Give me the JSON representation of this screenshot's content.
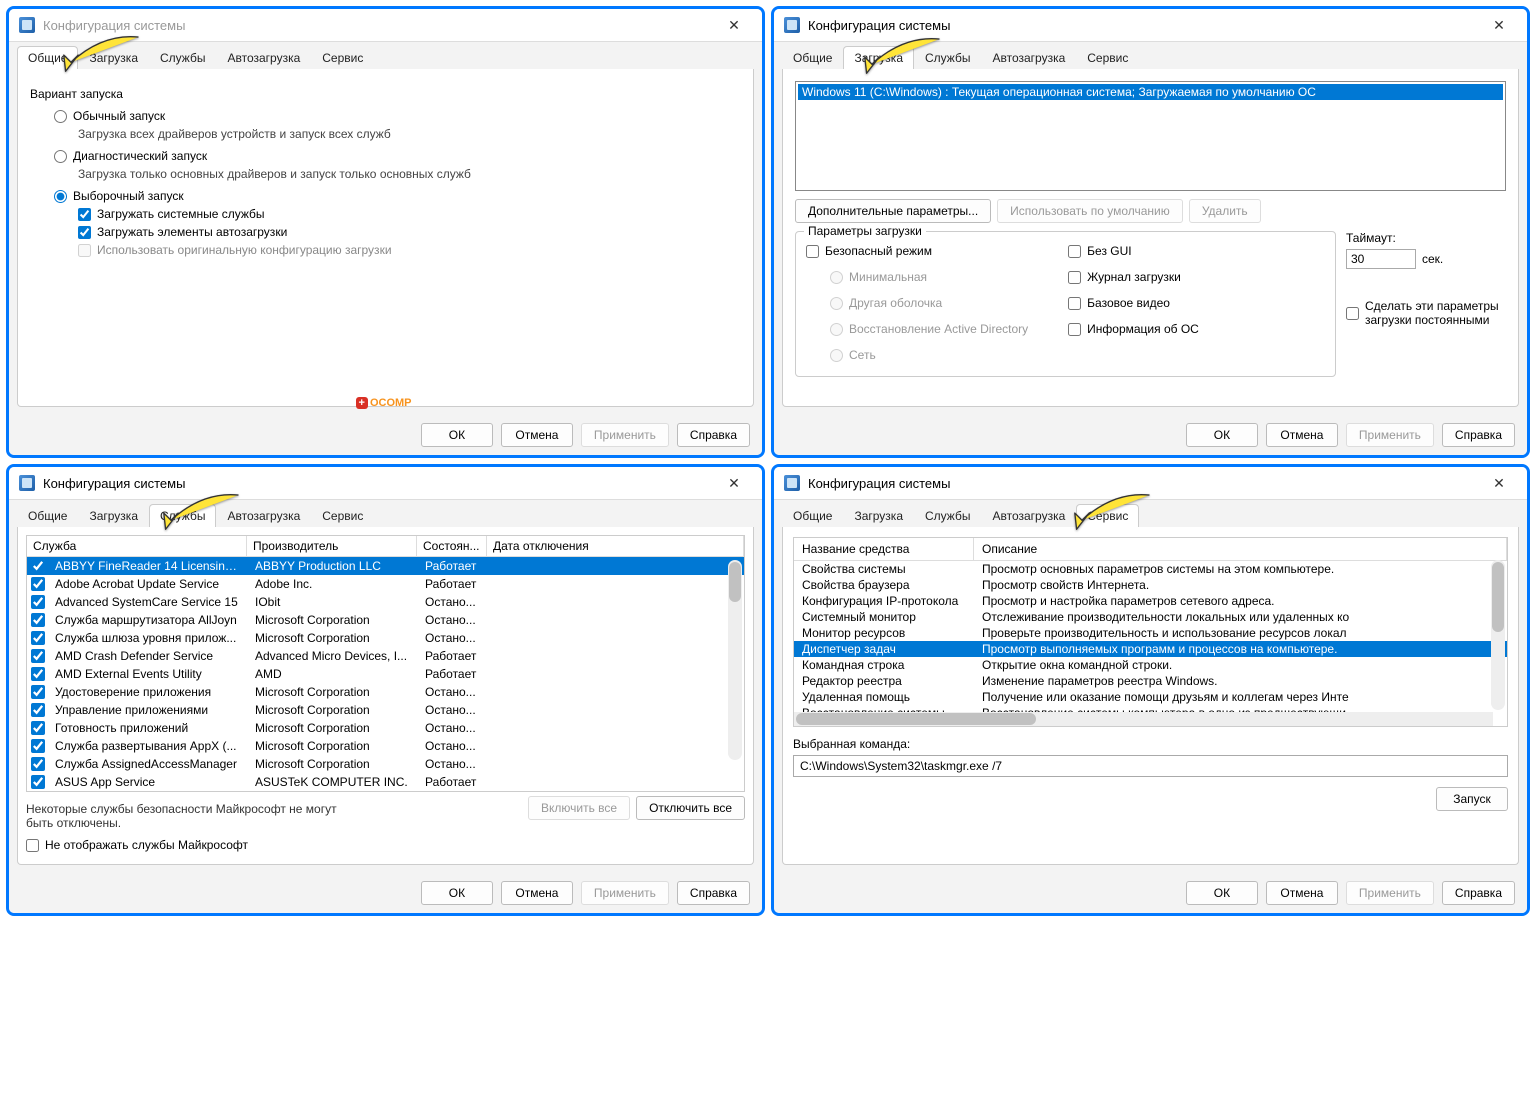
{
  "title": "Конфигурация системы",
  "tabs": [
    "Общие",
    "Загрузка",
    "Службы",
    "Автозагрузка",
    "Сервис"
  ],
  "buttons": {
    "ok": "ОК",
    "cancel": "Отмена",
    "apply": "Применить",
    "help": "Справка"
  },
  "w1": {
    "groupTitle": "Вариант запуска",
    "r1": "Обычный запуск",
    "r1d": "Загрузка всех драйверов устройств и запуск всех служб",
    "r2": "Диагностический запуск",
    "r2d": "Загрузка только основных драйверов и запуск только основных служб",
    "r3": "Выборочный запуск",
    "c1": "Загружать системные службы",
    "c2": "Загружать элементы автозагрузки",
    "c3": "Использовать оригинальную конфигурацию загрузки"
  },
  "w2": {
    "osline": "Windows 11 (C:\\Windows) : Текущая операционная система; Загружаемая по умолчанию ОС",
    "advbtn": "Дополнительные параметры...",
    "defbtn": "Использовать по умолчанию",
    "delbtn": "Удалить",
    "bootopts": "Параметры загрузки",
    "safe": "Безопасный режим",
    "min": "Минимальная",
    "shell": "Другая оболочка",
    "ad": "Восстановление Active Directory",
    "net": "Сеть",
    "nogui": "Без GUI",
    "bootlog": "Журнал загрузки",
    "basevid": "Базовое видео",
    "osinfo": "Информация об ОС",
    "timeout": "Таймаут:",
    "timeoutval": "30",
    "sec": "сек.",
    "persist": "Сделать эти параметры загрузки постоянными"
  },
  "w3": {
    "hdr": [
      "Служба",
      "Производитель",
      "Состоян...",
      "Дата отключения"
    ],
    "rows": [
      [
        "ABBYY FineReader 14 Licensing ...",
        "ABBYY Production LLC",
        "Работает"
      ],
      [
        "Adobe Acrobat Update Service",
        "Adobe Inc.",
        "Работает"
      ],
      [
        "Advanced SystemCare Service 15",
        "IObit",
        "Остано..."
      ],
      [
        "Служба маршрутизатора AllJoyn",
        "Microsoft Corporation",
        "Остано..."
      ],
      [
        "Служба шлюза уровня прилож...",
        "Microsoft Corporation",
        "Остано..."
      ],
      [
        "AMD Crash Defender Service",
        "Advanced Micro Devices, I...",
        "Работает"
      ],
      [
        "AMD External Events Utility",
        "AMD",
        "Работает"
      ],
      [
        "Удостоверение приложения",
        "Microsoft Corporation",
        "Остано..."
      ],
      [
        "Управление приложениями",
        "Microsoft Corporation",
        "Остано..."
      ],
      [
        "Готовность приложений",
        "Microsoft Corporation",
        "Остано..."
      ],
      [
        "Служба развертывания AppX (...",
        "Microsoft Corporation",
        "Остано..."
      ],
      [
        "Служба AssignedAccessManager",
        "Microsoft Corporation",
        "Остано..."
      ],
      [
        "ASUS App Service",
        "ASUSTeK COMPUTER INC.",
        "Работает"
      ]
    ],
    "note": "Некоторые службы безопасности Майкрософт не могут быть отключены.",
    "hide": "Не отображать службы Майкрософт",
    "enall": "Включить все",
    "disall": "Отключить все"
  },
  "w4": {
    "hdr": [
      "Название средства",
      "Описание"
    ],
    "rows": [
      [
        "Свойства системы",
        "Просмотр основных параметров системы на этом компьютере."
      ],
      [
        "Свойства браузера",
        "Просмотр свойств Интернета."
      ],
      [
        "Конфигурация IP-протокола",
        "Просмотр и настройка параметров сетевого адреса."
      ],
      [
        "Системный монитор",
        "Отслеживание производительности локальных или удаленных ко"
      ],
      [
        "Монитор ресурсов",
        "Проверьте производительность и использование ресурсов локал"
      ],
      [
        "Диспетчер задач",
        "Просмотр выполняемых программ и процессов на компьютере."
      ],
      [
        "Командная строка",
        "Открытие окна командной строки."
      ],
      [
        "Редактор реестра",
        "Изменение параметров реестра Windows."
      ],
      [
        "Удаленная помощь",
        "Получение или оказание помощи друзьям и коллегам через Инте"
      ],
      [
        "Восстановление системы",
        "Восстановление системы компьютера в одно из предшествующи"
      ]
    ],
    "selcmd_lbl": "Выбранная команда:",
    "selcmd": "C:\\Windows\\System32\\taskmgr.exe /7",
    "launch": "Запуск"
  },
  "watermark": "OCOMP"
}
